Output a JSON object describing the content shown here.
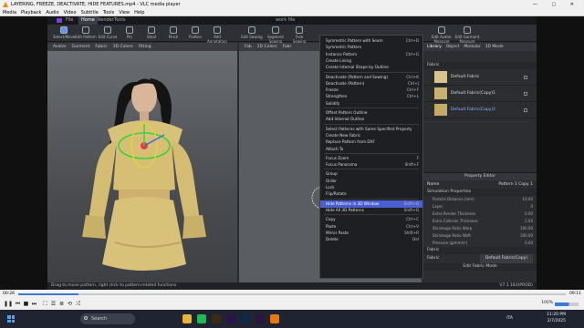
{
  "window": {
    "title": "LAYERING, FREEZE, DEACTIVATE, HIDE FEATURES.mp4 - VLC media player"
  },
  "menubar": [
    "Media",
    "Playback",
    "Audio",
    "Video",
    "Subtitle",
    "Tools",
    "View",
    "Help"
  ],
  "clo": {
    "file_label": "File",
    "tabs": [
      "Home",
      "Render",
      "Tools"
    ],
    "doc_label": "work file",
    "tools_left": [
      "Select/Move",
      "Edit Pattern",
      "Edit Curve",
      "Pin",
      "Steal",
      "Pinch",
      "Flatten",
      "Add Annotation"
    ],
    "tools_right": [
      "Edit Sewing",
      "Segment Sewing",
      "Free Sewing"
    ],
    "tools_far": [
      "Edit Avatar Measure",
      "Edit Garment Measure"
    ],
    "view3d_bar": [
      "Avatar",
      "Garment",
      "Fabric",
      "3D Colors",
      "Fitting"
    ],
    "view2d_bar": [
      "Fab",
      "2D Colors",
      "Fabr"
    ],
    "status_text": "Drag to move pattern, right click to pattern-related functions",
    "version": "V7.1.183(PROD)"
  },
  "panel": {
    "tabs": [
      "Library",
      "Object",
      "Modular",
      "3D Mode"
    ],
    "fabric_header": "Fabric",
    "fabrics": [
      {
        "name": "Default Fabric",
        "color": "#d8c38a"
      },
      {
        "name": "Default Fabric(Copy)1",
        "color": "#c7b070"
      },
      {
        "name": "Default Fabric(Copy)2",
        "color": "#c5aa66"
      }
    ]
  },
  "property_editor": {
    "title": "Property Editor",
    "name_label": "Name",
    "name_value": "Pattern 1 Copy 1",
    "section": "Simulation Properties",
    "rows": [
      {
        "label": "Particle Distance (mm)",
        "value": "10.00"
      },
      {
        "label": "Layer",
        "value": "0"
      },
      {
        "label": "Extra Render Thickness",
        "value": "0.00"
      },
      {
        "label": "Extra Collision Thickness",
        "value": "2.50"
      },
      {
        "label": "Shrinkage Ratio Warp",
        "value": "100.00"
      },
      {
        "label": "Shrinkage Ratio Weft",
        "value": "100.00"
      },
      {
        "label": "Pressure (g/mm/s²)",
        "value": "0.00"
      }
    ],
    "fabric_section": "Fabric",
    "fabric_label": "Fabric",
    "fabric_value": "Default Fabric(Copy)",
    "footer": "Edit Fabric Mode"
  },
  "context_menu": {
    "items": [
      {
        "label": "Symmetric Pattern with Seam",
        "shortcut": "Ctrl+D"
      },
      {
        "label": "Symmetric Pattern",
        "shortcut": ""
      },
      {
        "label": "Instance Pattern",
        "shortcut": "Ctrl+G"
      },
      {
        "label": "Create Lining",
        "shortcut": ""
      },
      {
        "label": "Create Internal Shape by Outline",
        "shortcut": ""
      },
      {
        "sep": true
      },
      {
        "label": "Deactivate (Pattern and Sewing)",
        "shortcut": "Ctrl+K"
      },
      {
        "label": "Deactivate (Pattern)",
        "shortcut": "Ctrl+J"
      },
      {
        "label": "Freeze",
        "shortcut": "Ctrl+F"
      },
      {
        "label": "Strengthen",
        "shortcut": "Ctrl+L"
      },
      {
        "label": "Solidify",
        "shortcut": ""
      },
      {
        "sep": true
      },
      {
        "label": "Offset Pattern Outline",
        "shortcut": ""
      },
      {
        "label": "Add Internal Outline",
        "shortcut": ""
      },
      {
        "sep": true
      },
      {
        "label": "Select Patterns with Same Specified Property",
        "shortcut": ""
      },
      {
        "label": "Create New Fabric",
        "shortcut": ""
      },
      {
        "label": "Replace Pattern from DXF",
        "shortcut": ""
      },
      {
        "label": "Attach To",
        "shortcut": ""
      },
      {
        "sep": true
      },
      {
        "label": "Focus Zoom",
        "shortcut": "F"
      },
      {
        "label": "Focus Panorama",
        "shortcut": "Shift+F"
      },
      {
        "sep": true
      },
      {
        "label": "Group",
        "shortcut": ""
      },
      {
        "label": "Order",
        "shortcut": ""
      },
      {
        "label": "Lock",
        "shortcut": ""
      },
      {
        "label": "Flip/Rotate",
        "shortcut": ""
      },
      {
        "sep": true
      },
      {
        "label": "Hide Patterns in 3D Window",
        "shortcut": "Shift+Q",
        "highlight": true
      },
      {
        "label": "Hide All 3D Patterns",
        "shortcut": "Shift+Q"
      },
      {
        "sep": true
      },
      {
        "label": "Copy",
        "shortcut": "Ctrl+C"
      },
      {
        "label": "Paste",
        "shortcut": "Ctrl+V"
      },
      {
        "label": "Mirror Paste",
        "shortcut": "Shift+R"
      },
      {
        "label": "Delete",
        "shortcut": "Del"
      }
    ]
  },
  "player": {
    "time_elapsed": "00:26",
    "time_total": "09:11",
    "progress": 0.11,
    "volume": 0.6,
    "volume_label": "100%",
    "buttons": [
      "play-pause",
      "prev",
      "stop",
      "next",
      "fullscreen",
      "extended",
      "playlist",
      "loop",
      "random"
    ]
  },
  "taskbar": {
    "search_text": "Search",
    "lang": "ITA",
    "time": "11:20 PM",
    "date": "2/7/2025",
    "apps": [
      {
        "name": "chrome",
        "color": "#e8b33a"
      },
      {
        "name": "spotify",
        "color": "#1db954"
      },
      {
        "name": "illustrator",
        "color": "#3a2a10"
      },
      {
        "name": "premiere",
        "color": "#2a1450"
      },
      {
        "name": "photoshop",
        "color": "#0c2a4a"
      },
      {
        "name": "after-effects",
        "color": "#2a1440"
      },
      {
        "name": "vlc",
        "color": "#e8790c"
      }
    ]
  }
}
